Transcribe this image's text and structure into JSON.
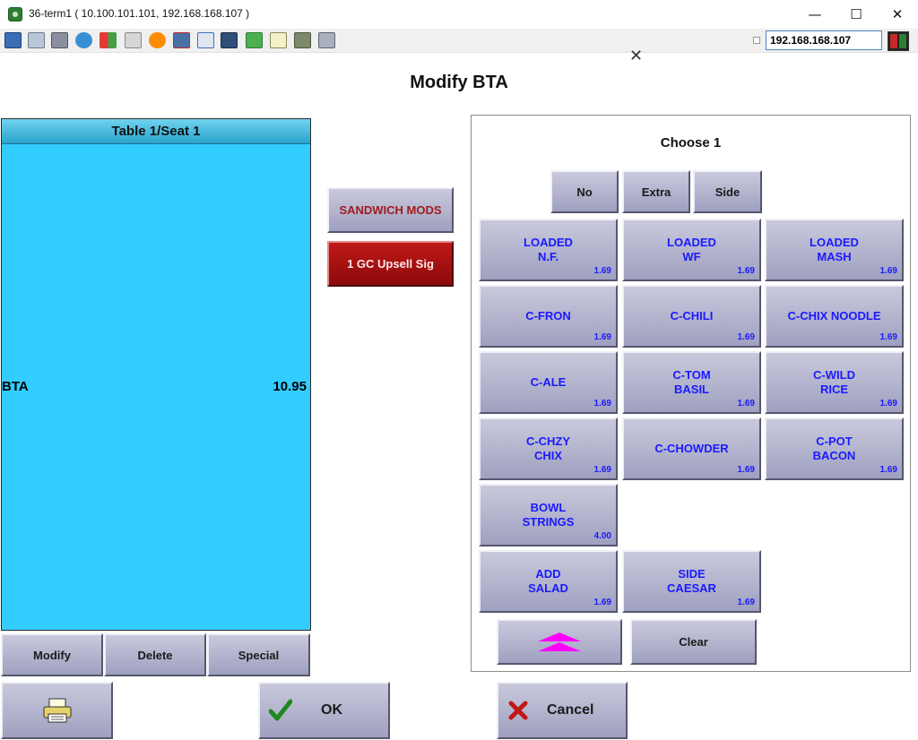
{
  "window": {
    "title": "36-term1 ( 10.100.101.101, 192.168.168.107 )",
    "minimize": "—",
    "maximize": "☐",
    "close": "✕"
  },
  "toolbar": {
    "ip_address": "192.168.168.107",
    "icons": [
      "monitor-icon",
      "windows-icon",
      "tools-icon",
      "refresh-icon",
      "windows-logo-icon",
      "keyboard-icon",
      "alert-icon",
      "network-icon",
      "fullscreen-icon",
      "display-icon",
      "transfer-icon",
      "file-icon",
      "screenshot-icon",
      "chat-icon"
    ]
  },
  "dialog": {
    "close": "✕",
    "title": "Modify BTA"
  },
  "check": {
    "header": "Table 1/Seat 1",
    "items": [
      {
        "name": "BTA",
        "price": "10.95"
      }
    ],
    "buttons": {
      "modify": "Modify",
      "delete": "Delete",
      "special": "Special"
    }
  },
  "middle": {
    "sandwich_mods": "SANDWICH MODS",
    "upsell": "1 GC Upsell Sig"
  },
  "modifiers": {
    "choose_label": "Choose 1",
    "qualifiers": {
      "no": "No",
      "extra": "Extra",
      "side": "Side"
    },
    "items": [
      {
        "line1": "LOADED",
        "line2": "N.F.",
        "price": "1.69"
      },
      {
        "line1": "LOADED",
        "line2": "WF",
        "price": "1.69"
      },
      {
        "line1": "LOADED",
        "line2": "MASH",
        "price": "1.69"
      },
      {
        "line1": "C-FRON",
        "line2": "",
        "price": "1.69"
      },
      {
        "line1": "C-CHILI",
        "line2": "",
        "price": "1.69"
      },
      {
        "line1": "C-CHIX NOODLE",
        "line2": "",
        "price": "1.69"
      },
      {
        "line1": "C-ALE",
        "line2": "",
        "price": "1.69"
      },
      {
        "line1": "C-TOM",
        "line2": "BASIL",
        "price": "1.69"
      },
      {
        "line1": "C-WILD",
        "line2": "RICE",
        "price": "1.69"
      },
      {
        "line1": "C-CHZY",
        "line2": "CHIX",
        "price": "1.69"
      },
      {
        "line1": "C-CHOWDER",
        "line2": "",
        "price": "1.69"
      },
      {
        "line1": "C-POT",
        "line2": "BACON",
        "price": "1.69"
      },
      {
        "line1": "BOWL",
        "line2": "STRINGS",
        "price": "4.00"
      },
      {
        "line1": "ADD",
        "line2": "SALAD",
        "price": "1.69"
      },
      {
        "line1": "SIDE",
        "line2": "CAESAR",
        "price": "1.69"
      }
    ],
    "clear": "Clear"
  },
  "footer": {
    "ok": "OK",
    "cancel": "Cancel"
  },
  "colors": {
    "check_bg": "#33ccff",
    "mod_text": "#1a1aff",
    "upsell_bg": "#a01010",
    "scroll_arrow": "#ff00ff"
  }
}
